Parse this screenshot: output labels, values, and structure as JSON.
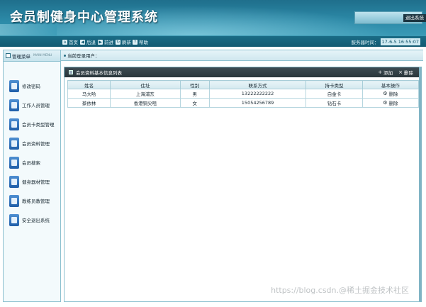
{
  "app": {
    "title": "会员制健身中心管理系统",
    "logout_label": "退出系统"
  },
  "toolbar": {
    "items": [
      {
        "label": "首页",
        "icon": "home-icon"
      },
      {
        "label": "后退",
        "icon": "back-icon"
      },
      {
        "label": "前进",
        "icon": "forward-icon"
      },
      {
        "label": "刷新",
        "icon": "refresh-icon"
      },
      {
        "label": "帮助",
        "icon": "help-icon"
      }
    ],
    "server_time_label": "服务器时间：",
    "server_time_value": "17-6-5 16:55:07"
  },
  "sidebar": {
    "title": "管理菜单",
    "subtitle": "MAIN MENU",
    "items": [
      {
        "label": "修改密码"
      },
      {
        "label": "工作人员管理"
      },
      {
        "label": "会员卡类型管理"
      },
      {
        "label": "会员资料管理"
      },
      {
        "label": "会员搜索"
      },
      {
        "label": "健身器材管理"
      },
      {
        "label": "教练员教管理"
      },
      {
        "label": "安全退出系统"
      }
    ]
  },
  "main": {
    "current_user_label": "当前登录用户："
  },
  "panel": {
    "title": "会员资料基本信息列表",
    "add_label": "添加",
    "delete_label": "删除",
    "columns": [
      "姓名",
      "住址",
      "性别",
      "联系方式",
      "持卡类型",
      "基本操作"
    ],
    "rows": [
      {
        "name": "马大哈",
        "address": "上海浦东",
        "gender": "男",
        "phone": "13222222222",
        "card": "白金卡",
        "action": "删除"
      },
      {
        "name": "蔡依林",
        "address": "香港铜尖咀",
        "gender": "女",
        "phone": "15054256789",
        "card": "钻石卡",
        "action": "删除"
      }
    ]
  },
  "watermark": "https://blog.csdn.@稀土掘金技术社区"
}
